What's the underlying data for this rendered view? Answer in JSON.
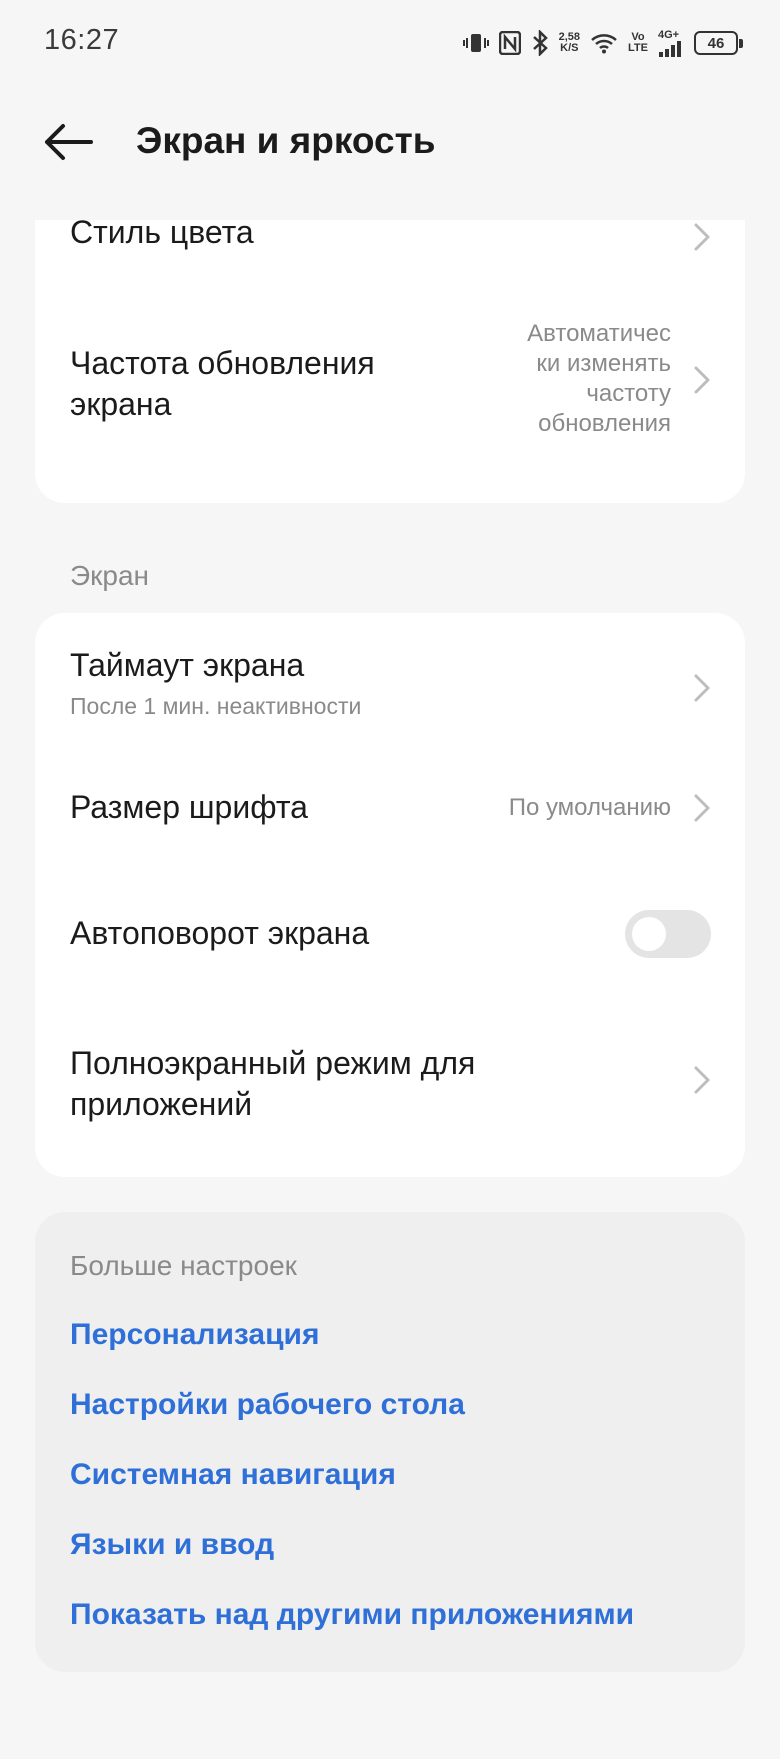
{
  "status_bar": {
    "time": "16:27",
    "net_speed_value": "2,58",
    "net_speed_unit": "K/S",
    "volte_top": "Vo",
    "volte_bottom": "LTE",
    "network": "4G+",
    "battery": "46",
    "icons": [
      "vibrate-icon",
      "nfc-icon",
      "bluetooth-icon",
      "wifi-icon",
      "signal-icon",
      "battery-icon"
    ]
  },
  "header": {
    "title": "Экран и яркость",
    "back_icon": "arrow-left-icon"
  },
  "top_group": {
    "color_style": {
      "title": "Стиль цвета"
    },
    "refresh_rate": {
      "title_line1": "Частота обновления",
      "title_line2": "экрана",
      "value_lines": [
        "Автоматичес",
        "ки изменять",
        "частоту",
        "обновления"
      ]
    }
  },
  "screen_section": {
    "label": "Экран",
    "timeout": {
      "title": "Таймаут экрана",
      "subtitle": "После 1 мин. неактивности"
    },
    "font_size": {
      "title": "Размер шрифта",
      "value": "По умолчанию"
    },
    "auto_rotate": {
      "title": "Автоповорот экрана",
      "enabled": false
    },
    "fullscreen": {
      "title_line1": "Полноэкранный режим для",
      "title_line2": "приложений"
    }
  },
  "more_settings": {
    "title": "Больше настроек",
    "links": [
      "Персонализация",
      "Настройки рабочего стола",
      "Системная навигация",
      "Языки и ввод",
      "Показать над другими приложениями"
    ]
  },
  "colors": {
    "background": "#f6f6f6",
    "card": "#ffffff",
    "more_card": "#efefef",
    "link": "#2f6fd8",
    "secondary_text": "#8a8a8a"
  }
}
